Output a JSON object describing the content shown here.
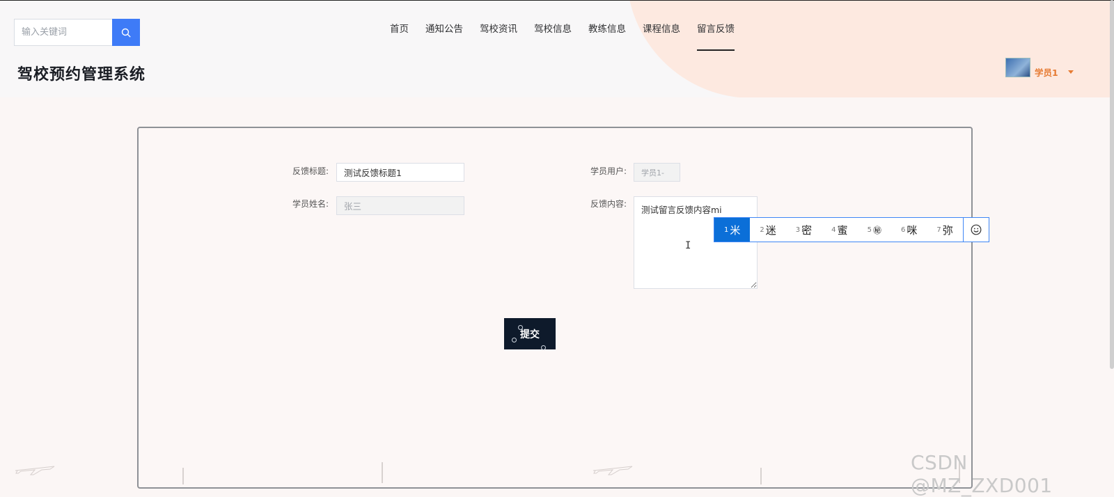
{
  "header": {
    "search": {
      "placeholder": "输入关键词",
      "value": ""
    },
    "nav": [
      {
        "label": "首页",
        "active": false
      },
      {
        "label": "通知公告",
        "active": false
      },
      {
        "label": "驾校资讯",
        "active": false
      },
      {
        "label": "驾校信息",
        "active": false
      },
      {
        "label": "教练信息",
        "active": false
      },
      {
        "label": "课程信息",
        "active": false
      },
      {
        "label": "留言反馈",
        "active": true
      }
    ],
    "site_title": "驾校预约管理系统",
    "user": {
      "name": "学员1"
    }
  },
  "form": {
    "title_label": "反馈标题:",
    "title_value": "测试反馈标题1",
    "student_user_label": "学员用户:",
    "student_user_value": "学员1-",
    "student_name_label": "学员姓名:",
    "student_name_value": "张三",
    "content_label": "反馈内容:",
    "content_value": "测试留言反馈内容mi",
    "submit_label": "提交"
  },
  "ime": {
    "candidates": [
      {
        "num": "1",
        "text": "米",
        "selected": true
      },
      {
        "num": "2",
        "text": "迷",
        "selected": false
      },
      {
        "num": "3",
        "text": "密",
        "selected": false
      },
      {
        "num": "4",
        "text": "蜜",
        "selected": false
      },
      {
        "num": "5",
        "text": "㊙",
        "selected": false
      },
      {
        "num": "6",
        "text": "咪",
        "selected": false
      },
      {
        "num": "7",
        "text": "弥",
        "selected": false
      }
    ],
    "emoji_icon": "smiley-icon"
  },
  "watermark": "CSDN @MZ_ZXD001",
  "colors": {
    "accent": "#3e7bf7",
    "user": "#e67b33",
    "submit_bg": "#0e1a2b",
    "ime_selected": "#0b6fd8"
  }
}
